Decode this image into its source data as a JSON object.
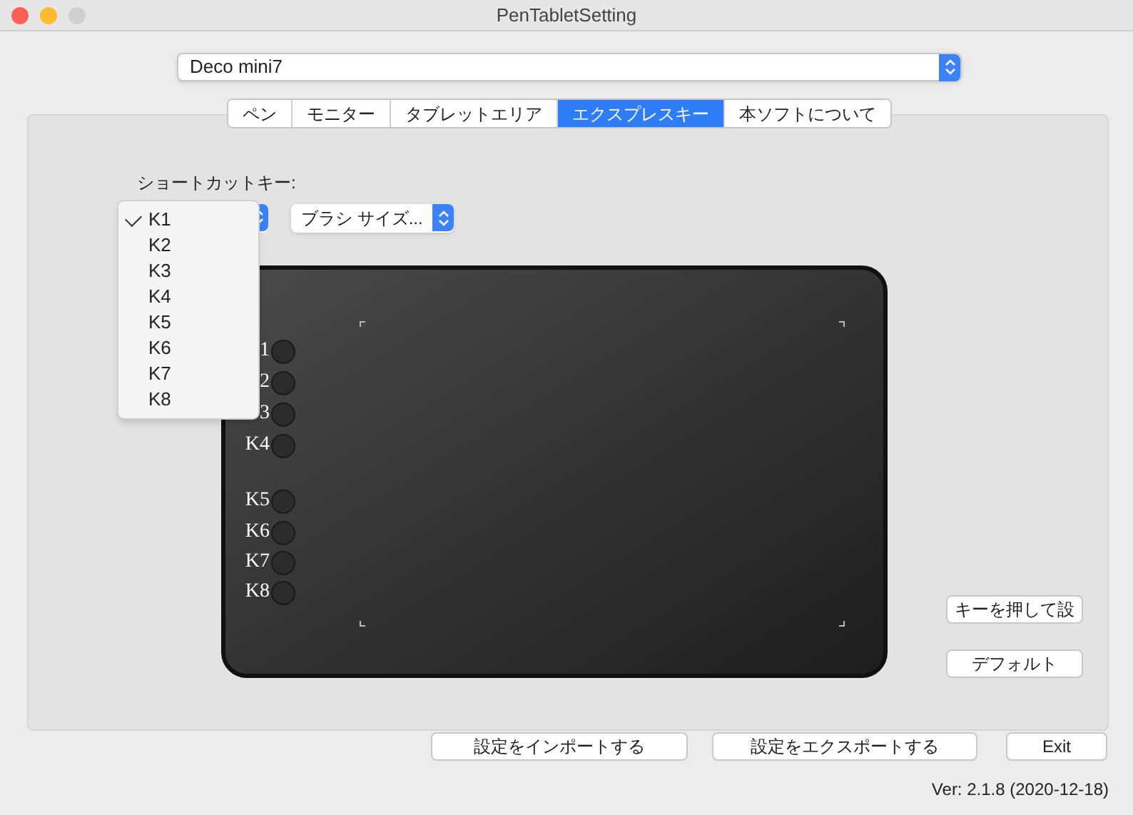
{
  "window": {
    "title": "PenTabletSetting"
  },
  "device_select": {
    "value": "Deco mini7"
  },
  "tabs": [
    {
      "label": "ペン",
      "selected": false
    },
    {
      "label": "モニター",
      "selected": false
    },
    {
      "label": "タブレットエリア",
      "selected": false
    },
    {
      "label": "エクスプレスキー",
      "selected": true
    },
    {
      "label": "本ソフトについて",
      "selected": false
    }
  ],
  "shortcut_label": "ショートカットキー:",
  "action_select": {
    "value": "ブラシ サイズ..."
  },
  "key_menu": [
    {
      "label": "K1",
      "selected": true
    },
    {
      "label": "K2",
      "selected": false
    },
    {
      "label": "K3",
      "selected": false
    },
    {
      "label": "K4",
      "selected": false
    },
    {
      "label": "K5",
      "selected": false
    },
    {
      "label": "K6",
      "selected": false
    },
    {
      "label": "K7",
      "selected": false
    },
    {
      "label": "K8",
      "selected": false
    }
  ],
  "tablet_keys": [
    {
      "label": "1"
    },
    {
      "label": "2"
    },
    {
      "label": "3"
    },
    {
      "label": "K4"
    },
    {
      "label": "K5"
    },
    {
      "label": "K6"
    },
    {
      "label": "K7"
    },
    {
      "label": "K8"
    }
  ],
  "side_buttons": [
    "キーを押して設",
    "デフォルト"
  ],
  "bottom_buttons": [
    "設定をインポートする",
    "設定をエクスポートする",
    "Exit"
  ],
  "version": "Ver: 2.1.8 (2020-12-18)"
}
